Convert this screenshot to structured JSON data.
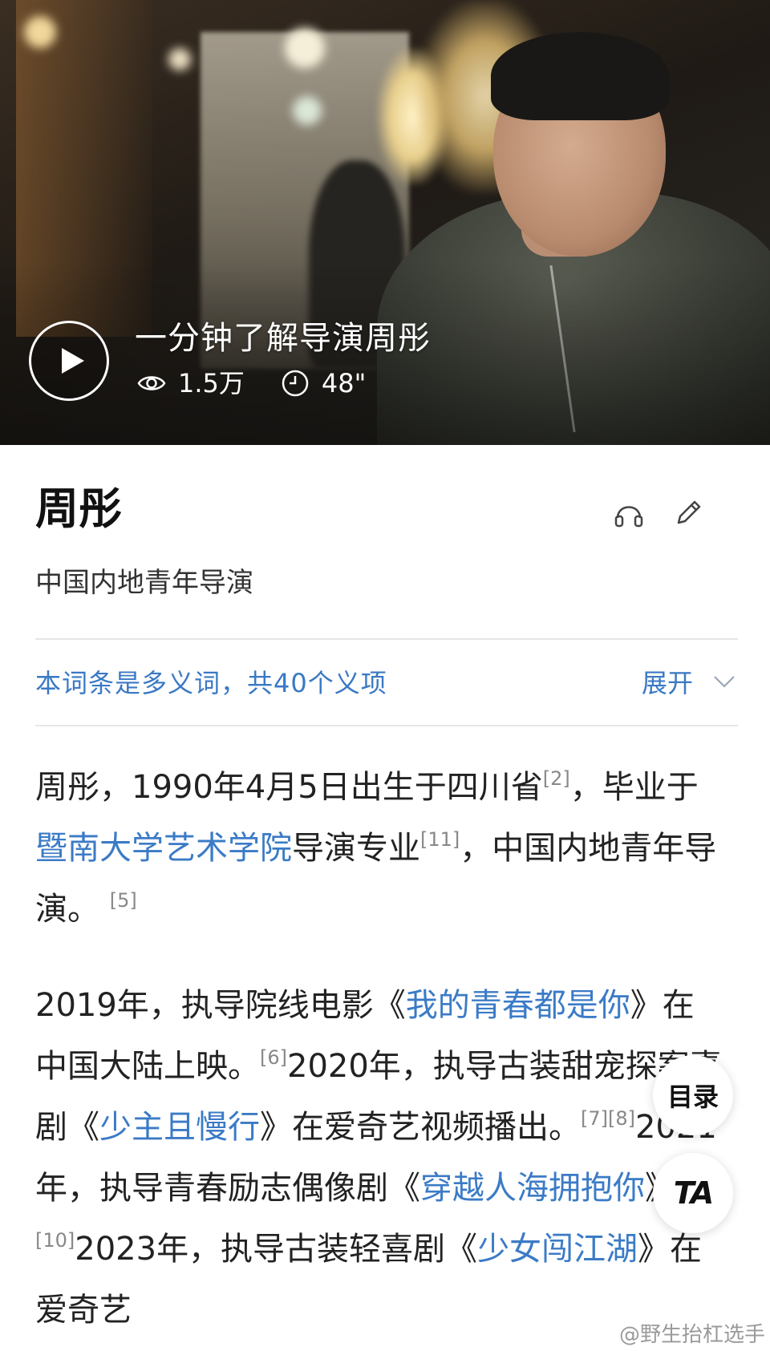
{
  "video": {
    "title": "一分钟了解导演周彤",
    "views": "1.5万",
    "duration": "48\"",
    "play_icon": "play-icon",
    "views_icon": "eye-icon",
    "duration_icon": "clock-icon"
  },
  "entry": {
    "title": "周彤",
    "subtitle": "中国内地青年导演",
    "tools": [
      "headphones-icon",
      "pencil-icon"
    ]
  },
  "polysemy": {
    "text": "本词条是多义词，共40个义项",
    "expand_label": "展开"
  },
  "paragraphs": {
    "p1": {
      "t1": "周彤，1990年4月5日出生于四川省",
      "r1": "[2]",
      "t2": "，毕业于",
      "l1": "暨南大学艺术学院",
      "t3": "导演专业",
      "r2": "[11]",
      "t4": "，中国内地青年导演。",
      "r3": "[5]"
    },
    "p2": {
      "t1": "2019年，执导院线电影《",
      "l1": "我的青春都是你",
      "t2": "》在中国大陆上映。",
      "r1": "[6]",
      "t3": "2020年，执导古装甜宠探案喜剧《",
      "l2": "少主且慢行",
      "t4": "》在爱奇艺视频播出。",
      "r2": "[7][8]",
      "t5": "2021年，执导青春励志偶像剧《",
      "l3": "穿越人海拥抱你",
      "t6": "》。",
      "r3": "[9][10]",
      "t7": "2023年，执导古装轻喜剧《",
      "l4": "少女闯江湖",
      "t8": "》在爱奇艺"
    }
  },
  "floating": {
    "toc_label": "目录",
    "ta_label": "TA"
  },
  "watermark": "@野生抬杠选手",
  "colors": {
    "link": "#3b7bc6",
    "polysemy": "#3a79c4",
    "text": "#222222"
  }
}
